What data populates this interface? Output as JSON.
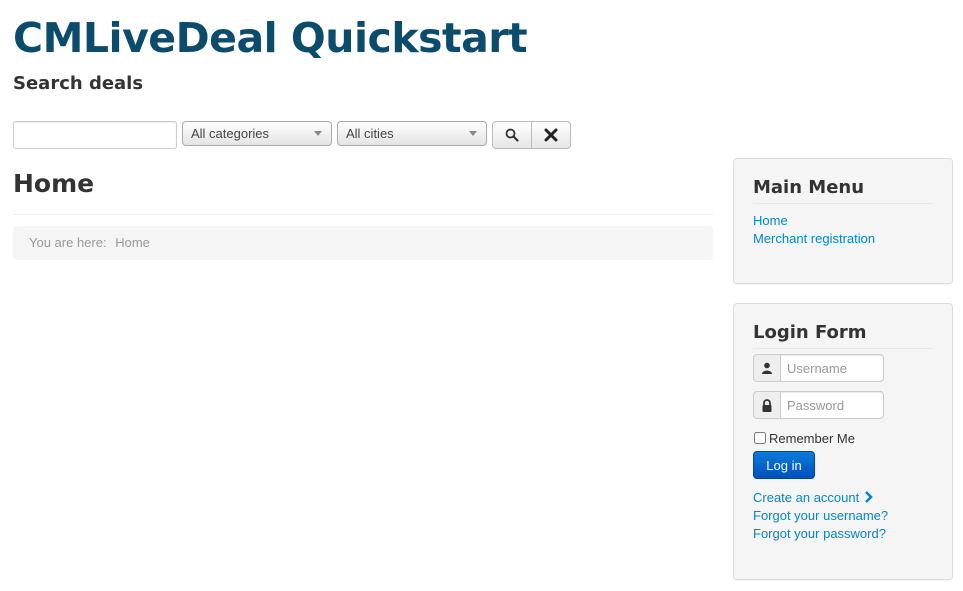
{
  "header": {
    "site_title": "CMLiveDeal Quickstart",
    "subtitle": "Search deals"
  },
  "search": {
    "input_value": "",
    "input_placeholder": "",
    "category_selected": "All categories",
    "city_selected": "All cities",
    "search_icon": "search-icon",
    "clear_icon": "close-icon"
  },
  "main": {
    "heading": "Home",
    "breadcrumb": {
      "prefix": "You are here:",
      "current": "Home"
    }
  },
  "sidebar": {
    "main_menu": {
      "title": "Main Menu",
      "items": [
        {
          "label": "Home"
        },
        {
          "label": "Merchant registration"
        }
      ]
    },
    "login_form": {
      "title": "Login Form",
      "username_placeholder": "Username",
      "password_placeholder": "Password",
      "remember_label": "Remember Me",
      "login_button": "Log in",
      "create_account": "Create an account",
      "forgot_username": "Forgot your username?",
      "forgot_password": "Forgot your password?"
    }
  },
  "colors": {
    "title": "#0b4b6b",
    "link": "#0088cc",
    "primary_button": "#0050c0"
  }
}
